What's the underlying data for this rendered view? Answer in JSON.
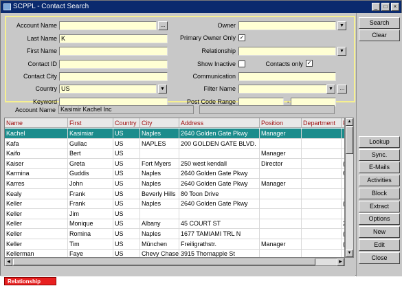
{
  "window": {
    "title": "SCPPL - Contact Search",
    "minimize": "_",
    "maximize": "□",
    "close": "×"
  },
  "form": {
    "account_name": {
      "label": "Account Name",
      "value": ""
    },
    "last_name": {
      "label": "Last Name",
      "value": "K"
    },
    "first_name": {
      "label": "First Name",
      "value": ""
    },
    "contact_id": {
      "label": "Contact ID",
      "value": ""
    },
    "contact_city": {
      "label": "Contact City",
      "value": ""
    },
    "country": {
      "label": "Country",
      "value": "US"
    },
    "keyword": {
      "label": "Keyword",
      "value": ""
    },
    "owner": {
      "label": "Owner",
      "value": ""
    },
    "primary_owner_only": {
      "label": "Primary Owner Only",
      "checked": "✓"
    },
    "relationship": {
      "label": "Relationship",
      "value": ""
    },
    "show_inactive": {
      "label": "Show Inactive",
      "checked": ""
    },
    "contacts_only": {
      "label": "Contacts only",
      "checked": "✓"
    },
    "communication": {
      "label": "Communication",
      "value": ""
    },
    "filter_name": {
      "label": "Filter Name",
      "value": ""
    },
    "post_code_range": {
      "label": "Post Code Range",
      "from": "",
      "separator": "-",
      "to": ""
    }
  },
  "account_info": {
    "label": "Account Name",
    "value": "Kasimir Kachel Inc",
    "extra": ""
  },
  "grid": {
    "columns": [
      "Name",
      "First",
      "Country",
      "City",
      "Address",
      "Position",
      "Department",
      "F"
    ],
    "rows": [
      {
        "name": "Kachel",
        "first": "Kasimiar",
        "country": "US",
        "city": "Naples",
        "address": "2640 Golden Gate Pkwy",
        "position": "Manager",
        "department": "",
        "f": ""
      },
      {
        "name": "Kafa",
        "first": "Gullac",
        "country": "US",
        "city": "NAPLES",
        "address": "200 GOLDEN GATE BLVD.",
        "position": "",
        "department": "",
        "f": ""
      },
      {
        "name": "Kaifo",
        "first": "Bert",
        "country": "US",
        "city": "",
        "address": "",
        "position": "Manager",
        "department": "",
        "f": ""
      },
      {
        "name": "Kaiser",
        "first": "Greta",
        "country": "US",
        "city": "Fort Myers",
        "address": "250 west kendall",
        "position": "Director",
        "department": "",
        "f": "(:"
      },
      {
        "name": "Karmina",
        "first": "Guddis",
        "country": "US",
        "city": "Naples",
        "address": "2640 Golden Gate Pkwy",
        "position": "",
        "department": "",
        "f": "6"
      },
      {
        "name": "Karres",
        "first": "John",
        "country": "US",
        "city": "Naples",
        "address": "2640 Golden Gate Pkwy",
        "position": "Manager",
        "department": "",
        "f": ""
      },
      {
        "name": "Kealy",
        "first": "Frank",
        "country": "US",
        "city": "Beverly Hills",
        "address": "80 Toon Drive",
        "position": "",
        "department": "",
        "f": ""
      },
      {
        "name": "Keller",
        "first": "Frank",
        "country": "US",
        "city": "Naples",
        "address": "2640 Golden Gate Pkwy",
        "position": "",
        "department": "",
        "f": "(:"
      },
      {
        "name": "Keller",
        "first": "Jim",
        "country": "US",
        "city": "",
        "address": "",
        "position": "",
        "department": "",
        "f": ""
      },
      {
        "name": "Keller",
        "first": "Monique",
        "country": "US",
        "city": "Albany",
        "address": "45 COURT ST",
        "position": "",
        "department": "",
        "f": "2"
      },
      {
        "name": "Keller",
        "first": "Romina",
        "country": "US",
        "city": "Naples",
        "address": "1677 TAMIAMI TRL N",
        "position": "",
        "department": "",
        "f": "(:"
      },
      {
        "name": "Keller",
        "first": "Tim",
        "country": "US",
        "city": "München",
        "address": "Freiligrathstr.",
        "position": "Manager",
        "department": "",
        "f": "(:"
      },
      {
        "name": "Kellerman",
        "first": "Faye",
        "country": "US",
        "city": "Chevy Chase",
        "address": "3915 Thornapple St",
        "position": "",
        "department": "",
        "f": ""
      }
    ]
  },
  "status": {
    "label": "Relationship",
    "color": "#e82020"
  },
  "buttons": {
    "search": "Search",
    "clear": "Clear",
    "lookup": "Lookup",
    "sync": "Sync.",
    "emails": "E-Mails",
    "activities": "Activities",
    "block": "Block",
    "extract": "Extract",
    "options": "Options",
    "new": "New",
    "edit": "Edit",
    "close": "Close"
  },
  "colors": {
    "selected_row": "#1c8c8c",
    "field_bg": "#ffffd4",
    "header_text": "#a01010",
    "title_bar": "#0a2a6e"
  }
}
